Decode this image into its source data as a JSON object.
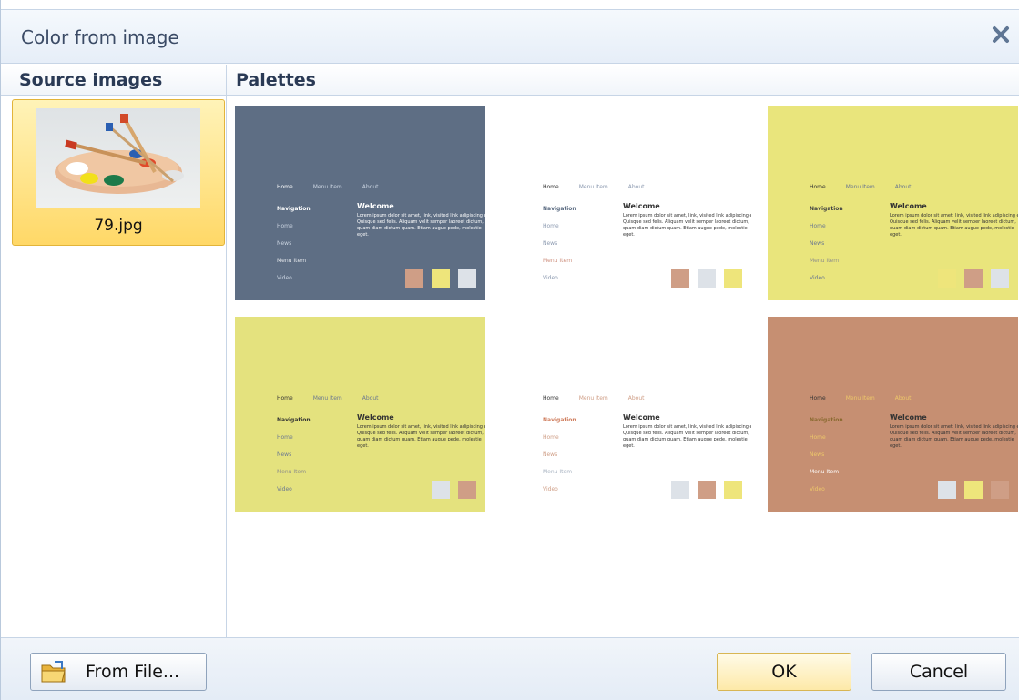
{
  "dialog": {
    "title": "Color from image"
  },
  "headers": {
    "source": "Source images",
    "palettes": "Palettes"
  },
  "source_images": [
    {
      "label": "79.jpg",
      "selected": true
    }
  ],
  "footer": {
    "from_file": "From File...",
    "ok": "OK",
    "cancel": "Cancel"
  },
  "palette_text": {
    "nav": [
      "Home",
      "Menu Item",
      "About"
    ],
    "side": [
      "Navigation",
      "Home",
      "News",
      "Menu Item",
      "Video"
    ],
    "welcome": "Welcome",
    "lorem": "Lorem ipsum dolor sit amet, link, visited link adipiscing elit. Quisque sed felis. Aliquam velit semper laoreet dictum, quam diam dictum quam. Etiam augue pede, molestie eget."
  },
  "palettes": [
    {
      "bg": "#5e6e84",
      "text": "#ffffff",
      "nav_head": "#ffffff",
      "link": "#c9d3e0",
      "hover": "#e5e8ec",
      "swatches": [
        "#cf9e86",
        "#eee57b",
        "#dde2e8"
      ]
    },
    {
      "bg": "#ffffff",
      "text": "#333333",
      "nav_head": "#5e6e84",
      "link": "#8c9ab0",
      "hover": "#cc8c7a",
      "swatches": [
        "#cf9e86",
        "#dde2e8",
        "#eee57b"
      ]
    },
    {
      "bg": "#e9e57c",
      "text": "#333333",
      "nav_head": "#444444",
      "link": "#6b7890",
      "hover": "#8f8e8a",
      "swatches": [
        "#eee57b",
        "#cf9e86",
        "#dde2e8"
      ]
    },
    {
      "bg": "#e4e27e",
      "text": "#333333",
      "nav_head": "#333333",
      "link": "#6b7890",
      "hover": "#8f8e8a",
      "swatches": [
        "#e4e27e",
        "#dde2e8",
        "#cf9e86"
      ]
    },
    {
      "bg": "#ffffff",
      "text": "#333333",
      "nav_head": "#cf7c5c",
      "link": "#cf9e86",
      "hover": "#a9b4c2",
      "swatches": [
        "#dde2e8",
        "#cf9e86",
        "#eee57b"
      ]
    },
    {
      "bg": "#c68f72",
      "text": "#333333",
      "nav_head": "#8a6a30",
      "link": "#eec86a",
      "hover": "#ffffff",
      "swatches": [
        "#dde2e8",
        "#eee57b",
        "#cf9e86"
      ]
    }
  ]
}
